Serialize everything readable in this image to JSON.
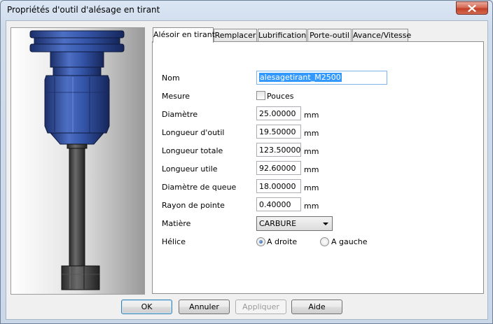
{
  "window": {
    "title": "Propriétés d'outil d'alésage en tirant"
  },
  "tabs": [
    {
      "label": "Alésoir en tirant",
      "active": true
    },
    {
      "label": "Remplacer",
      "active": false
    },
    {
      "label": "Lubrification",
      "active": false
    },
    {
      "label": "Porte-outil",
      "active": false
    },
    {
      "label": "Avance/Vitesse",
      "active": false
    }
  ],
  "form": {
    "nom": {
      "label": "Nom",
      "value": "alesagetirant_M2500"
    },
    "mesure": {
      "label": "Mesure",
      "checkbox_label": "Pouces",
      "checked": false
    },
    "fields": [
      {
        "label": "Diamètre",
        "value": "25.00000",
        "unit": "mm"
      },
      {
        "label": "Longueur d'outil",
        "value": "19.50000",
        "unit": "mm"
      },
      {
        "label": "Longueur totale",
        "value": "123.50000",
        "unit": "mm"
      },
      {
        "label": "Longueur utile",
        "value": "92.60000",
        "unit": "mm"
      },
      {
        "label": "Diamètre de queue",
        "value": "18.00000",
        "unit": "mm"
      },
      {
        "label": "Rayon de pointe",
        "value": "0.40000",
        "unit": "mm"
      }
    ],
    "matiere": {
      "label": "Matière",
      "value": "CARBURE"
    },
    "helice": {
      "label": "Hélice",
      "options": [
        {
          "label": "A droite",
          "checked": true
        },
        {
          "label": "A gauche",
          "checked": false
        }
      ]
    }
  },
  "buttons": {
    "ok": "OK",
    "cancel": "Annuler",
    "apply": "Appliquer",
    "help": "Aide"
  },
  "colors": {
    "tool_body": "#3a5aa8",
    "shank": "#4a4a4a",
    "accent": "#3399ff"
  }
}
